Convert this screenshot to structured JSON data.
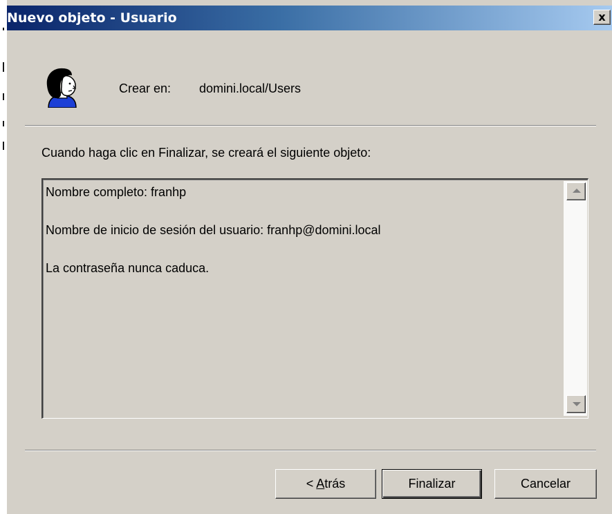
{
  "window": {
    "title": "Nuevo objeto - Usuario",
    "close_glyph": "x",
    "close_icon": "close-icon",
    "titlebar_colors": [
      "#0a246a",
      "#a6caf0"
    ]
  },
  "header": {
    "icon": "user-icon",
    "create_in_label": "Crear en:",
    "create_in_value": "domini.local/Users"
  },
  "instruction": "Cuando haga clic en Finalizar, se creará el siguiente objeto:",
  "summary": {
    "lines": [
      "Nombre completo: franhp",
      "Nombre de inicio de sesión del usuario: franhp@domini.local",
      "La contraseña nunca caduca."
    ]
  },
  "buttons": {
    "back": {
      "prefix": "< ",
      "mnemonic": "A",
      "rest": "trás"
    },
    "finish": "Finalizar",
    "cancel": "Cancelar"
  }
}
